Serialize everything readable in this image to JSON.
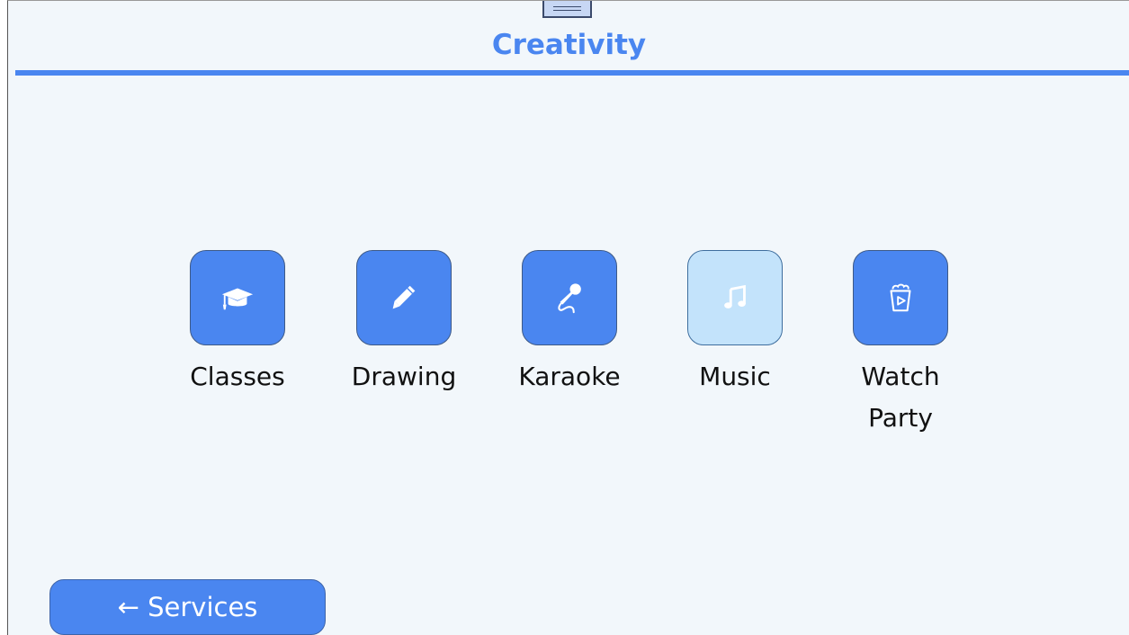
{
  "header": {
    "title": "Creativity"
  },
  "tiles": [
    {
      "label": "Classes",
      "icon": "graduation-cap-icon",
      "selected": false
    },
    {
      "label": "Drawing",
      "icon": "pencil-icon",
      "selected": false
    },
    {
      "label": "Karaoke",
      "icon": "microphone-icon",
      "selected": false
    },
    {
      "label": "Music",
      "icon": "music-note-icon",
      "selected": true
    },
    {
      "label": "Watch\nParty",
      "icon": "popcorn-play-icon",
      "selected": false
    }
  ],
  "footer": {
    "back_label": "← Services"
  },
  "colors": {
    "accent": "#4a86f0",
    "background": "#f2f7fb",
    "selected_tile": "#c3e3fb"
  }
}
